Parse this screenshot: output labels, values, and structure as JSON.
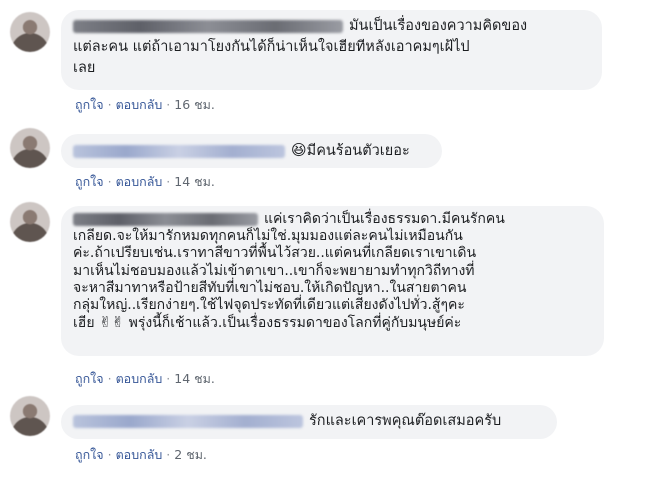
{
  "actions": {
    "like": "ถูกใจ",
    "reply": "ตอบกลับ",
    "separator": "·"
  },
  "comments": [
    {
      "lines": [
        "มันเป็นเรื่องของความคิดของ",
        "แต่ละคน แต่ถ้าเอามาโยงกันได้ก็น่าเห็นใจเฮียทีหลังเอาคมๆเฝ้ไป",
        "เลย"
      ],
      "time": "16 ชม."
    },
    {
      "emoji": "😆",
      "text": "มีคนร้อนตัวเยอะ",
      "time": "14 ชม."
    },
    {
      "lines": [
        "แค่เราคิดว่าเป็นเรื่องธรรมดา.มีคนรักคน",
        "เกลียด.จะให้มารักหมดทุกคนก็ไม่ใช่.มุมมองแต่ละคนไม่เหมือนกัน",
        "ค่ะ.ถ้าเปรียบเช่น.เราทาสีขาวที่พื้นไว้สวย..แต่คนที่เกลียดเราเขาเดิน",
        "มาเห็นไม่ชอบมองแล้วไม่เข้าตาเขา..เขาก็จะพยายามทำทุกวิถีทางที่",
        "จะหาสีมาทาหรือป้ายสีทับที่เขาไม่ชอบ.ให้เกิดปัญหา..ในสายตาคน",
        "กลุ่มใหญ่..เรียกง่ายๆ.ใช้ไฟจุดประทัดที่เดียวแต่เสียงดังไปทั่ว.สู้ๆคะ",
        "เฮีย",
        "พรุ่งนี้ก็เช้าแล้ว.เป็นเรื่องธรรมดาของโลกที่คู่กับมนุษย์ค่ะ"
      ],
      "victory": "✌✌",
      "time": "14 ชม."
    },
    {
      "text": "รักและเคารพคุณต๊อดเสมอครับ",
      "time": "2 ชม."
    }
  ]
}
